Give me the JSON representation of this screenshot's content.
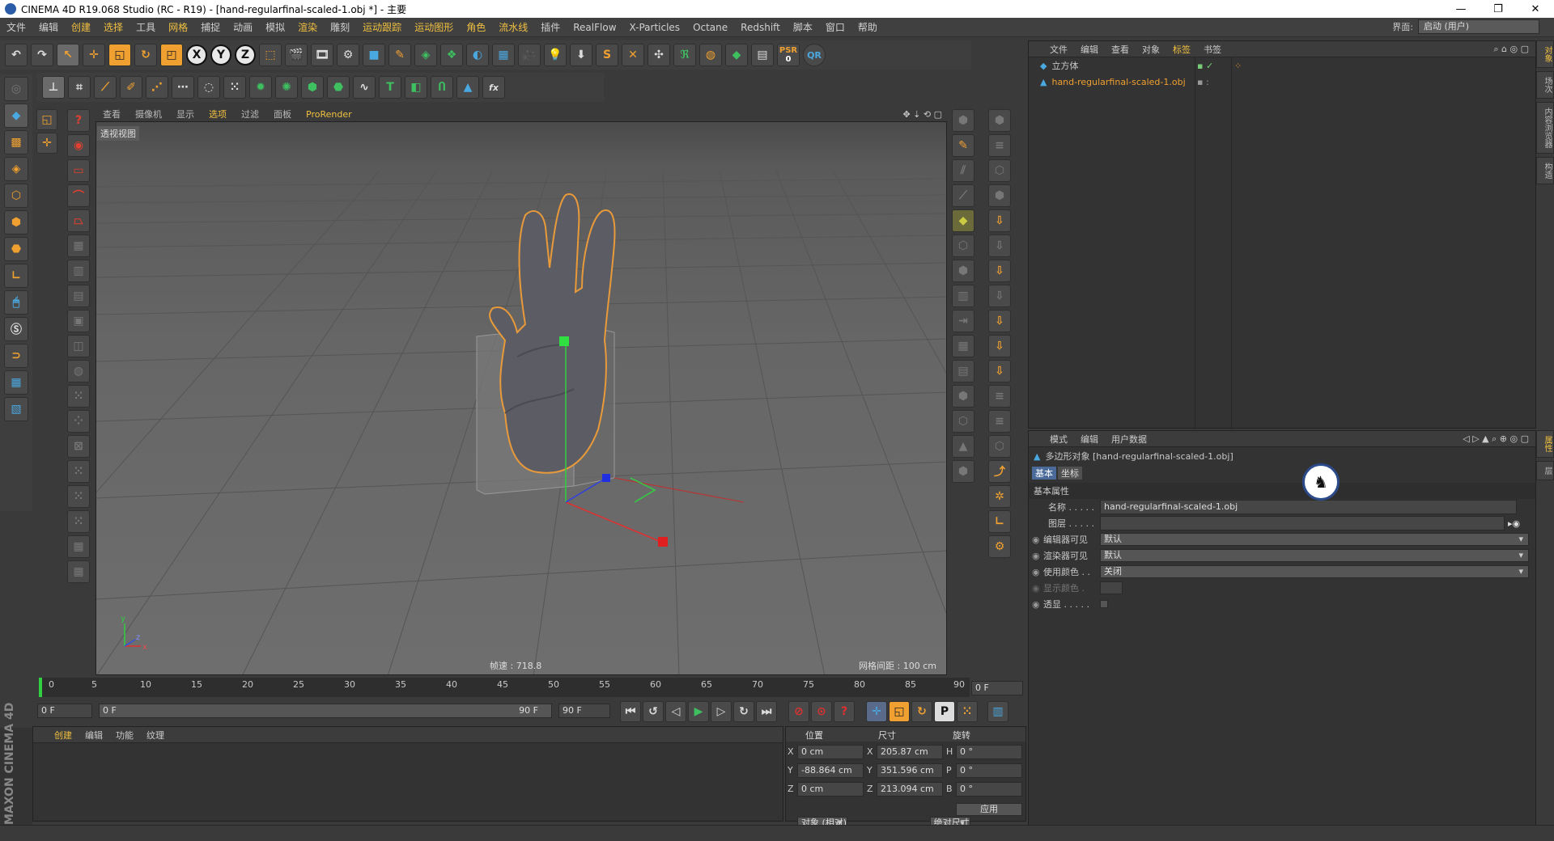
{
  "window": {
    "title": "CINEMA 4D R19.068 Studio (RC - R19) - [hand-regularfinal-scaled-1.obj *] - 主要",
    "min": "—",
    "restore": "❐",
    "close": "✕"
  },
  "menu": [
    "文件",
    "编辑",
    "创建",
    "选择",
    "工具",
    "网格",
    "捕捉",
    "动画",
    "模拟",
    "渲染",
    "雕刻",
    "运动跟踪",
    "运动图形",
    "角色",
    "流水线",
    "插件",
    "RealFlow",
    "X-Particles",
    "Octane",
    "Redshift",
    "脚本",
    "窗口",
    "帮助"
  ],
  "layout": {
    "label": "界面:",
    "value": "启动 (用户)"
  },
  "toolbar1": {
    "undo": "↶",
    "redo": "↷",
    "x": "X",
    "y": "Y",
    "z": "Z",
    "psr": "PSR",
    "psr_value": "0",
    "qr": "QR"
  },
  "toolbar2_text": {
    "t": "T",
    "fx": "fx"
  },
  "viewport": {
    "menu": [
      "查看",
      "摄像机",
      "显示",
      "选项",
      "过滤",
      "面板",
      "ProRender"
    ],
    "label": "透视视图",
    "fps": "帧速 : 718.8",
    "grid": "网格间距 : 100 cm",
    "axis_y": "y",
    "axis_z": "z",
    "axis_x": "x"
  },
  "timeline": {
    "ticks": [
      "0",
      "5",
      "10",
      "15",
      "20",
      "25",
      "30",
      "35",
      "40",
      "45",
      "50",
      "55",
      "60",
      "65",
      "70",
      "75",
      "80",
      "85",
      "90"
    ],
    "current": "0 F",
    "start": "0 F",
    "range_start": "0 F",
    "range_end": "90 F",
    "end": "90 F"
  },
  "material": {
    "menu": [
      "创建",
      "编辑",
      "功能",
      "纹理"
    ]
  },
  "brand": "MAXON CINEMA 4D",
  "coords": {
    "headers": [
      "位置",
      "尺寸",
      "旋转"
    ],
    "rows": [
      {
        "axis": "X",
        "pos": "0 cm",
        "size_axis": "X",
        "size": "205.87 cm",
        "rot_axis": "H",
        "rot": "0 °"
      },
      {
        "axis": "Y",
        "pos": "-88.864 cm",
        "size_axis": "Y",
        "size": "351.596 cm",
        "rot_axis": "P",
        "rot": "0 °"
      },
      {
        "axis": "Z",
        "pos": "0 cm",
        "size_axis": "Z",
        "size": "213.094 cm",
        "rot_axis": "B",
        "rot": "0 °"
      }
    ],
    "mode": "对象 (相对)",
    "size_mode": "绝对尺寸",
    "apply": "应用"
  },
  "objects": {
    "menu": [
      "文件",
      "编辑",
      "查看",
      "对象",
      "标签",
      "书签"
    ],
    "items": [
      {
        "name": "立方体",
        "color": "#d0d0d0"
      },
      {
        "name": "hand-regularfinal-scaled-1.obj",
        "color": "#f0a030"
      }
    ]
  },
  "attributes": {
    "menu": [
      "模式",
      "编辑",
      "用户数据"
    ],
    "title": "多边形对象 [hand-regularfinal-scaled-1.obj]",
    "tabs": [
      "基本",
      "坐标"
    ],
    "section": "基本属性",
    "fields": [
      {
        "label": "名称 . . . . .",
        "value": "hand-regularfinal-scaled-1.obj"
      },
      {
        "label": "图层 . . . . .",
        "value": ""
      }
    ],
    "dropdowns": [
      {
        "label": "编辑器可见",
        "value": "默认"
      },
      {
        "label": "渲染器可见",
        "value": "默认"
      },
      {
        "label": "使用颜色 . .",
        "value": "关闭"
      }
    ],
    "display_color": "显示颜色 .",
    "xray": "透显 . . . . ."
  },
  "right_tabs": [
    "对象",
    "场次",
    "内容浏览器",
    "构造"
  ],
  "right_tabs2": [
    "属性",
    "层"
  ],
  "colors": {
    "accent": "#f0a030",
    "highlight": "#f0c040",
    "blue": "#4aa8e0"
  }
}
